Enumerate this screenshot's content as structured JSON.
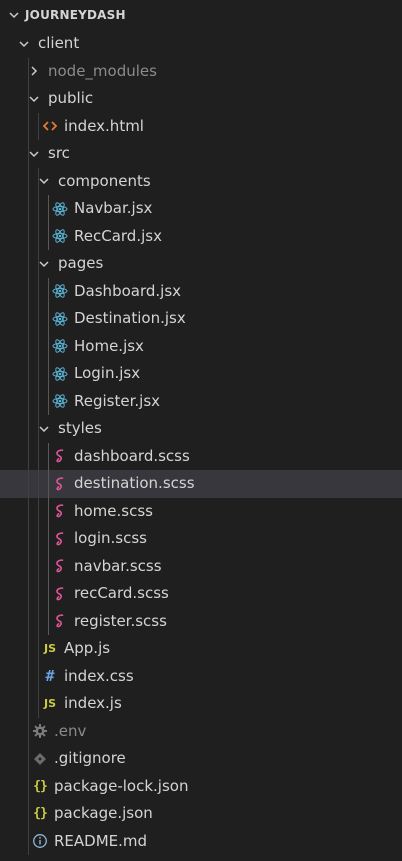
{
  "explorer": {
    "root_title": "JOURNEYDASH"
  },
  "tree": [
    {
      "label": "client",
      "level": 0,
      "kind": "folder-open",
      "icon": "chevron-down-icon",
      "name": "folder-client"
    },
    {
      "label": "node_modules",
      "level": 1,
      "kind": "folder-closed",
      "icon": "chevron-right-icon",
      "name": "folder-node-modules",
      "dim": true
    },
    {
      "label": "public",
      "level": 1,
      "kind": "folder-open",
      "icon": "chevron-down-icon",
      "name": "folder-public"
    },
    {
      "label": "index.html",
      "level": 2,
      "kind": "html",
      "icon": "html-file-icon",
      "name": "file-index-html"
    },
    {
      "label": "src",
      "level": 1,
      "kind": "folder-open",
      "icon": "chevron-down-icon",
      "name": "folder-src"
    },
    {
      "label": "components",
      "level": 2,
      "kind": "folder-open",
      "icon": "chevron-down-icon",
      "name": "folder-components"
    },
    {
      "label": "Navbar.jsx",
      "level": 3,
      "kind": "react",
      "icon": "react-file-icon",
      "name": "file-navbar-jsx"
    },
    {
      "label": "RecCard.jsx",
      "level": 3,
      "kind": "react",
      "icon": "react-file-icon",
      "name": "file-reccard-jsx"
    },
    {
      "label": "pages",
      "level": 2,
      "kind": "folder-open",
      "icon": "chevron-down-icon",
      "name": "folder-pages"
    },
    {
      "label": "Dashboard.jsx",
      "level": 3,
      "kind": "react",
      "icon": "react-file-icon",
      "name": "file-dashboard-jsx"
    },
    {
      "label": "Destination.jsx",
      "level": 3,
      "kind": "react",
      "icon": "react-file-icon",
      "name": "file-destination-jsx"
    },
    {
      "label": "Home.jsx",
      "level": 3,
      "kind": "react",
      "icon": "react-file-icon",
      "name": "file-home-jsx"
    },
    {
      "label": "Login.jsx",
      "level": 3,
      "kind": "react",
      "icon": "react-file-icon",
      "name": "file-login-jsx"
    },
    {
      "label": "Register.jsx",
      "level": 3,
      "kind": "react",
      "icon": "react-file-icon",
      "name": "file-register-jsx"
    },
    {
      "label": "styles",
      "level": 2,
      "kind": "folder-open",
      "icon": "chevron-down-icon",
      "name": "folder-styles"
    },
    {
      "label": "dashboard.scss",
      "level": 3,
      "kind": "sass",
      "icon": "sass-file-icon",
      "name": "file-dashboard-scss"
    },
    {
      "label": "destination.scss",
      "level": 3,
      "kind": "sass",
      "icon": "sass-file-icon",
      "name": "file-destination-scss",
      "selected": true
    },
    {
      "label": "home.scss",
      "level": 3,
      "kind": "sass",
      "icon": "sass-file-icon",
      "name": "file-home-scss"
    },
    {
      "label": "login.scss",
      "level": 3,
      "kind": "sass",
      "icon": "sass-file-icon",
      "name": "file-login-scss"
    },
    {
      "label": "navbar.scss",
      "level": 3,
      "kind": "sass",
      "icon": "sass-file-icon",
      "name": "file-navbar-scss"
    },
    {
      "label": "recCard.scss",
      "level": 3,
      "kind": "sass",
      "icon": "sass-file-icon",
      "name": "file-reccard-scss"
    },
    {
      "label": "register.scss",
      "level": 3,
      "kind": "sass",
      "icon": "sass-file-icon",
      "name": "file-register-scss"
    },
    {
      "label": "App.js",
      "level": 2,
      "kind": "js",
      "icon": "javascript-file-icon",
      "name": "file-app-js"
    },
    {
      "label": "index.css",
      "level": 2,
      "kind": "css",
      "icon": "css-file-icon",
      "name": "file-index-css"
    },
    {
      "label": "index.js",
      "level": 2,
      "kind": "js",
      "icon": "javascript-file-icon",
      "name": "file-index-js"
    },
    {
      "label": ".env",
      "level": 1,
      "kind": "env",
      "icon": "gear-icon",
      "name": "file-env",
      "dim": true
    },
    {
      "label": ".gitignore",
      "level": 1,
      "kind": "git",
      "icon": "git-diamond-icon",
      "name": "file-gitignore"
    },
    {
      "label": "package-lock.json",
      "level": 1,
      "kind": "json",
      "icon": "json-file-icon",
      "name": "file-package-lock-json"
    },
    {
      "label": "package.json",
      "level": 1,
      "kind": "json",
      "icon": "json-file-icon",
      "name": "file-package-json"
    },
    {
      "label": "README.md",
      "level": 1,
      "kind": "info",
      "icon": "info-icon",
      "name": "file-readme-md"
    }
  ],
  "colors": {
    "background": "#1f1f1f",
    "selected_row": "#37373d",
    "text": "#d4d4d4",
    "dim_text": "#8b8b8b",
    "react": "#5ab4d6",
    "sass": "#e0559a",
    "js": "#cbcb41",
    "css": "#6c9ee0",
    "html": "#e37933",
    "json": "#cbcb41",
    "info": "#8fb5d8",
    "env": "#7b7b7b",
    "git": "#6b6b6b"
  }
}
